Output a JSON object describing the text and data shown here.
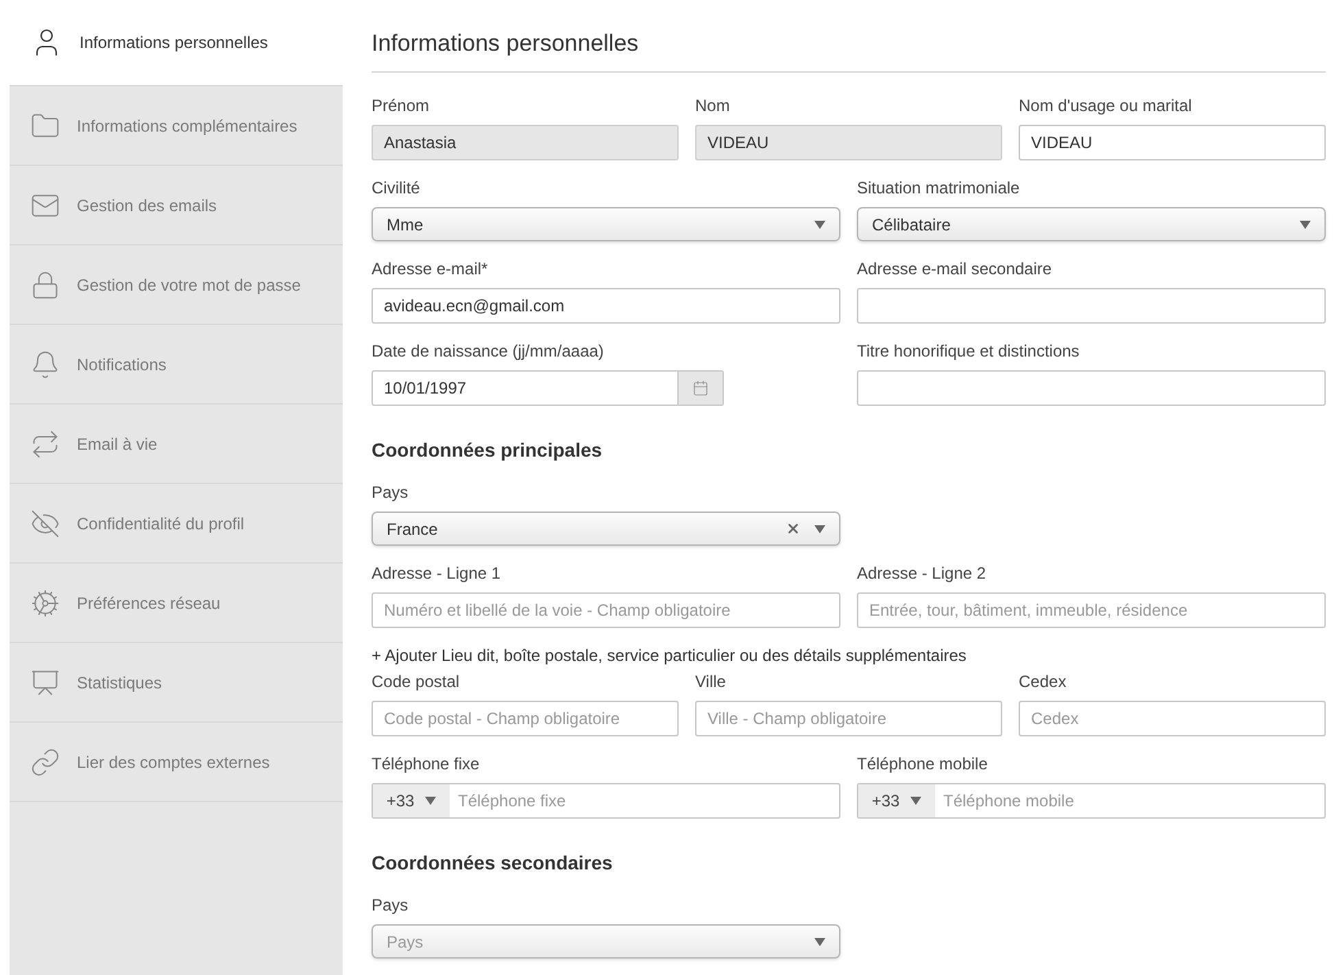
{
  "sidebar": {
    "items": [
      {
        "label": "Informations personnelles",
        "selected": true
      },
      {
        "label": "Informations complémentaires",
        "selected": false
      },
      {
        "label": "Gestion des emails",
        "selected": false
      },
      {
        "label": "Gestion de votre mot de passe",
        "selected": false
      },
      {
        "label": "Notifications",
        "selected": false
      },
      {
        "label": "Email à vie",
        "selected": false
      },
      {
        "label": "Confidentialité du profil",
        "selected": false
      },
      {
        "label": "Préférences réseau",
        "selected": false
      },
      {
        "label": "Statistiques",
        "selected": false
      },
      {
        "label": "Lier des comptes externes",
        "selected": false
      }
    ]
  },
  "main": {
    "title": "Informations personnelles",
    "sections": [
      {
        "items": [
          {
            "kind": "row",
            "fields": [
              {
                "kind": "text",
                "label": "Prénom",
                "value": "Anastasia",
                "disabled": true
              },
              {
                "kind": "text",
                "label": "Nom",
                "value": "VIDEAU",
                "disabled": true
              },
              {
                "kind": "text",
                "label": "Nom d'usage ou marital",
                "value": "VIDEAU",
                "disabled": false
              }
            ]
          },
          {
            "kind": "row",
            "fields": [
              {
                "kind": "select",
                "label": "Civilité",
                "value": "Mme",
                "clearable": false
              },
              {
                "kind": "select",
                "label": "Situation matrimoniale",
                "value": "Célibataire",
                "clearable": false
              }
            ]
          },
          {
            "kind": "row",
            "fields": [
              {
                "kind": "text",
                "label": "Adresse e-mail*",
                "value": "avideau.ecn@gmail.com",
                "disabled": false
              },
              {
                "kind": "text",
                "label": "Adresse e-mail secondaire",
                "disabled": false
              }
            ]
          },
          {
            "kind": "row",
            "fields": [
              {
                "kind": "date",
                "label": "Date de naissance (jj/mm/aaaa)",
                "value": "10/01/1997"
              },
              {
                "kind": "text",
                "label": "Titre honorifique et distinctions",
                "disabled": false
              }
            ]
          }
        ]
      },
      {
        "heading": "Coordonnées principales",
        "items": [
          {
            "kind": "row",
            "fields": [
              {
                "kind": "select",
                "label": "Pays",
                "value": "France",
                "clearable": true
              }
            ]
          },
          {
            "kind": "row",
            "fields": [
              {
                "kind": "text",
                "label": "Adresse - Ligne 1",
                "placeholder": "Numéro et libellé de la voie - Champ obligatoire",
                "disabled": false
              },
              {
                "kind": "text",
                "label": "Adresse - Ligne 2",
                "placeholder": "Entrée, tour, bâtiment, immeuble, résidence",
                "disabled": false
              }
            ]
          },
          {
            "kind": "link",
            "text": "+ Ajouter Lieu dit, boîte postale, service particulier ou des détails supplémentaires"
          },
          {
            "kind": "row",
            "fields": [
              {
                "kind": "text",
                "label": "Code postal",
                "placeholder": "Code postal - Champ obligatoire",
                "disabled": false
              },
              {
                "kind": "text",
                "label": "Ville",
                "placeholder": "Ville - Champ obligatoire",
                "disabled": false
              },
              {
                "kind": "text",
                "label": "Cedex",
                "placeholder": "Cedex",
                "disabled": false
              }
            ]
          },
          {
            "kind": "row",
            "fields": [
              {
                "kind": "phone",
                "label": "Téléphone fixe",
                "prefix": "+33",
                "placeholder": "Téléphone fixe"
              },
              {
                "kind": "phone",
                "label": "Téléphone mobile",
                "prefix": "+33",
                "placeholder": "Téléphone mobile"
              }
            ]
          }
        ]
      },
      {
        "heading": "Coordonnées secondaires",
        "items": [
          {
            "kind": "row",
            "fields": [
              {
                "kind": "select",
                "label": "Pays",
                "placeholder": "Pays",
                "clearable": false
              }
            ]
          }
        ]
      }
    ]
  }
}
